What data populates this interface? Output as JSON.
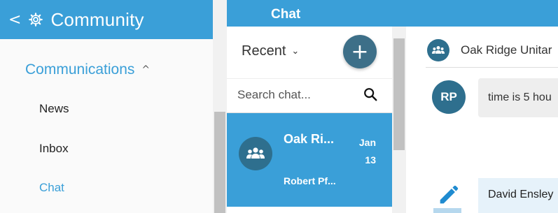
{
  "sidebar": {
    "back_glyph": "<",
    "title": "Community",
    "section_label": "Communications",
    "section_caret": "^",
    "items": [
      {
        "label": "News"
      },
      {
        "label": "Inbox"
      },
      {
        "label": "Chat",
        "active": true
      }
    ]
  },
  "chat": {
    "header_title": "Chat",
    "recent_label": "Recent",
    "new_chat_glyph": "+",
    "search_placeholder": "Search chat...",
    "conversations": [
      {
        "name": "Oak Ri...",
        "date_month": "Jan",
        "date_day": "13",
        "preview": "Robert Pf..."
      }
    ]
  },
  "conversation": {
    "title": "Oak Ridge Unitar",
    "messages": [
      {
        "avatar_initials": "RP",
        "text": "time is 5 hou"
      },
      {
        "text": "David Ensley"
      }
    ]
  },
  "colors": {
    "accent": "#3a9fd8",
    "dark_accent": "#2e6f8e",
    "fab": "#3d6f88"
  },
  "icons": [
    "gear-icon",
    "search-icon",
    "group-icon",
    "pencil-icon",
    "chevron-down-icon",
    "chevron-up-icon"
  ]
}
